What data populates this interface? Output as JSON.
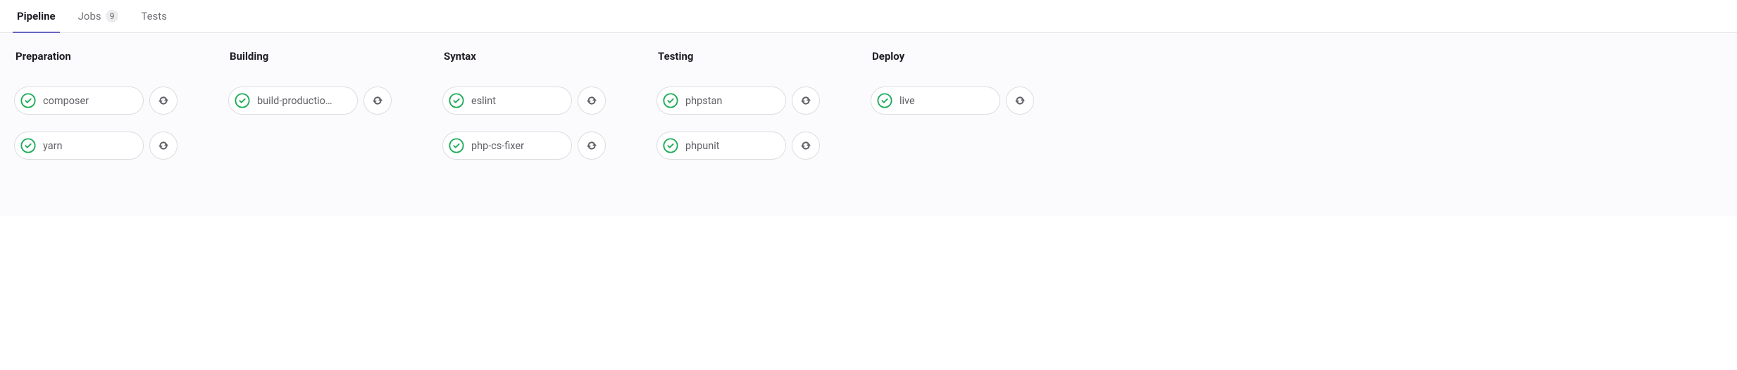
{
  "tabs": {
    "pipeline": "Pipeline",
    "jobs": "Jobs",
    "jobs_count": "9",
    "tests": "Tests"
  },
  "stages": [
    {
      "title": "Preparation",
      "jobs": [
        {
          "name": "composer",
          "status": "success"
        },
        {
          "name": "yarn",
          "status": "success"
        }
      ]
    },
    {
      "title": "Building",
      "jobs": [
        {
          "name": "build-productio…",
          "status": "success"
        }
      ]
    },
    {
      "title": "Syntax",
      "jobs": [
        {
          "name": "eslint",
          "status": "success"
        },
        {
          "name": "php-cs-fixer",
          "status": "success"
        }
      ]
    },
    {
      "title": "Testing",
      "jobs": [
        {
          "name": "phpstan",
          "status": "success"
        },
        {
          "name": "phpunit",
          "status": "success"
        }
      ]
    },
    {
      "title": "Deploy",
      "jobs": [
        {
          "name": "live",
          "status": "success"
        }
      ]
    }
  ]
}
